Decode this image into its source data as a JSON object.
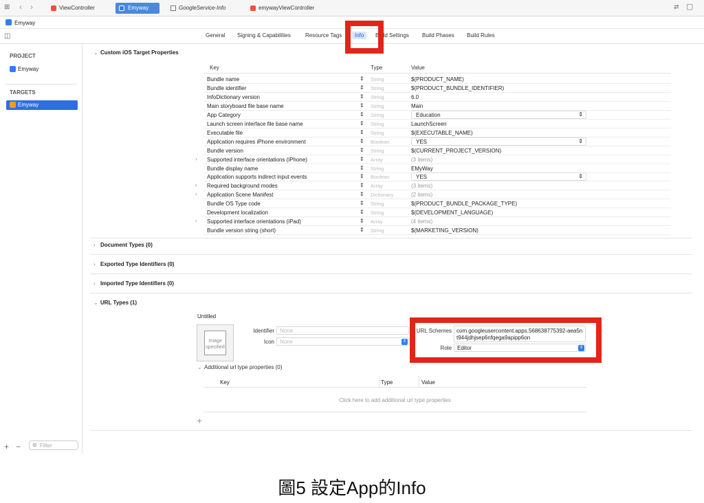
{
  "tabs": [
    {
      "label": "ViewController",
      "icon": "swift-file-icon"
    },
    {
      "label": "Emyway",
      "icon": "project-icon"
    },
    {
      "label": "GoogleService-Info",
      "icon": "plist-file-icon"
    },
    {
      "label": "emywayViewController",
      "icon": "swift-file-icon"
    }
  ],
  "breadcrumb": "Emyway",
  "setting_tabs": [
    "General",
    "Signing & Capabilities",
    "Resource Tags",
    "Info",
    "Build Settings",
    "Build Phases",
    "Build Rules"
  ],
  "sidebar": {
    "project_header": "PROJECT",
    "project_item": "Emyway",
    "targets_header": "TARGETS",
    "target_item": "Emyway",
    "filter_placeholder": "Filter"
  },
  "custom_props": {
    "title": "Custom iOS Target Properties",
    "col_key": "Key",
    "col_type": "Type",
    "col_value": "Value",
    "rows": [
      {
        "key": "Bundle name",
        "type": "String",
        "value": "$(PRODUCT_NAME)"
      },
      {
        "key": "Bundle identifier",
        "type": "String",
        "value": "$(PRODUCT_BUNDLE_IDENTIFIER)"
      },
      {
        "key": "InfoDictionary version",
        "type": "String",
        "value": "6.0"
      },
      {
        "key": "Main storyboard file base name",
        "type": "String",
        "value": "Main"
      },
      {
        "key": "App Category",
        "type": "String",
        "value": "Education"
      },
      {
        "key": "Launch screen interface file base name",
        "type": "String",
        "value": "LaunchScreen"
      },
      {
        "key": "Executable file",
        "type": "String",
        "value": "$(EXECUTABLE_NAME)"
      },
      {
        "key": "Application requires iPhone environment",
        "type": "Boolean",
        "value": "YES"
      },
      {
        "key": "Bundle version",
        "type": "String",
        "value": "$(CURRENT_PROJECT_VERSION)"
      },
      {
        "key": "Supported interface orientations (iPhone)",
        "type": "Array",
        "value": "(3 items)"
      },
      {
        "key": "Bundle display name",
        "type": "String",
        "value": "EMyWay"
      },
      {
        "key": "Application supports indirect input events",
        "type": "Boolean",
        "value": "YES"
      },
      {
        "key": "Required background modes",
        "type": "Array",
        "value": "(3 items)"
      },
      {
        "key": "Application Scene Manifest",
        "type": "Dictionary",
        "value": "(2 items)"
      },
      {
        "key": "Bundle OS Type code",
        "type": "String",
        "value": "$(PRODUCT_BUNDLE_PACKAGE_TYPE)"
      },
      {
        "key": "Development localization",
        "type": "String",
        "value": "$(DEVELOPMENT_LANGUAGE)"
      },
      {
        "key": "Supported interface orientations (iPad)",
        "type": "Array",
        "value": "(4 items)"
      },
      {
        "key": "Bundle version string (short)",
        "type": "String",
        "value": "$(MARKETING_VERSION)"
      }
    ]
  },
  "sections": {
    "document_types": "Document Types (0)",
    "exported_types": "Exported Type Identifiers (0)",
    "imported_types": "Imported Type Identifiers (0)",
    "url_types": "URL Types (1)"
  },
  "url_type": {
    "name": "Untitled",
    "image_placeholder": "Image specified",
    "identifier_label": "Identifier",
    "identifier_placeholder": "None",
    "icon_label": "Icon",
    "icon_placeholder": "None",
    "url_schemes_label": "URL Schemes",
    "url_schemes_value": "com.googleusercontent.apps.568638775392-aea5nt944jdhjsep6nfqega9apipp6on",
    "role_label": "Role",
    "role_value": "Editor",
    "additional_props": "Additional url type properties (0)",
    "col_key": "Key",
    "col_type": "Type",
    "col_value": "Value",
    "empty_hint": "Click here to add additional url type properties"
  },
  "caption": "圖5 設定App的Info",
  "colors": {
    "highlight": "#e1251b",
    "selection": "#2f6ee0"
  }
}
